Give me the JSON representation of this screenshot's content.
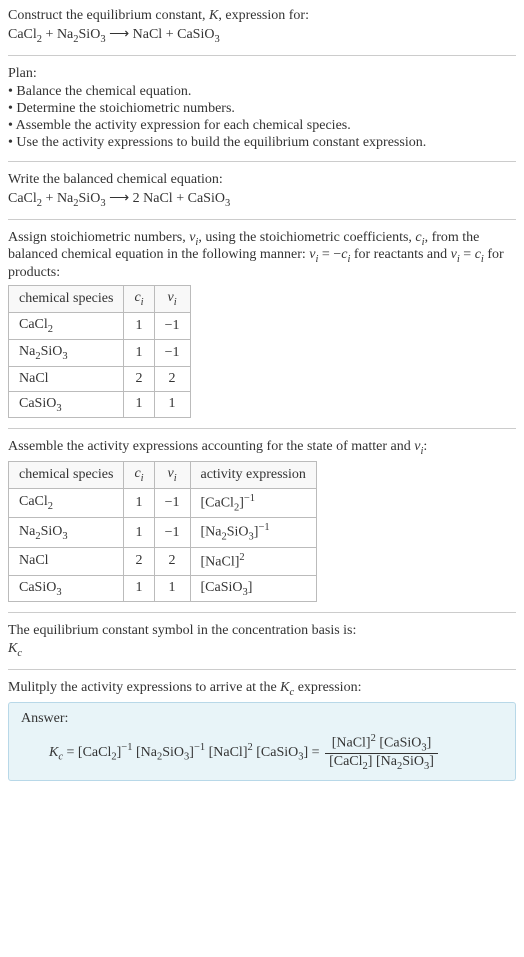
{
  "header": {
    "title_prefix": "Construct the equilibrium constant, ",
    "title_var": "K",
    "title_suffix": ", expression for:",
    "equation_lhs1": "CaCl",
    "equation_lhs1_sub": "2",
    "plus": " + ",
    "equation_lhs2a": "Na",
    "equation_lhs2a_sub": "2",
    "equation_lhs2b": "SiO",
    "equation_lhs2b_sub": "3",
    "arrow": " ⟶ ",
    "equation_rhs1": "NaCl",
    "equation_rhs2a": "CaSiO",
    "equation_rhs2a_sub": "3"
  },
  "plan": {
    "title": "Plan:",
    "items": [
      "• Balance the chemical equation.",
      "• Determine the stoichiometric numbers.",
      "• Assemble the activity expression for each chemical species.",
      "• Use the activity expressions to build the equilibrium constant expression."
    ]
  },
  "balanced": {
    "title": "Write the balanced chemical equation:",
    "coef_nacl": "2 "
  },
  "stoich": {
    "text_a": "Assign stoichiometric numbers, ",
    "nu_i": "ν",
    "nu_i_sub": "i",
    "text_b": ", using the stoichiometric coefficients, ",
    "c_i": "c",
    "c_i_sub": "i",
    "text_c": ", from the balanced chemical equation in the following manner: ",
    "eq1_lhs": "ν",
    "eq1_eq": " = −",
    "text_d": " for reactants and ",
    "eq2_eq": " = ",
    "text_e": " for products:",
    "table": {
      "headers": [
        "chemical species",
        "cᵢ",
        "νᵢ"
      ],
      "h0": "chemical species",
      "h1_a": "c",
      "h1_b": "i",
      "h2_a": "ν",
      "h2_b": "i",
      "rows": [
        {
          "species_a": "CaCl",
          "species_a_sub": "2",
          "species_b": "",
          "species_b_sub": "",
          "c": "1",
          "nu": "−1"
        },
        {
          "species_a": "Na",
          "species_a_sub": "2",
          "species_b": "SiO",
          "species_b_sub": "3",
          "c": "1",
          "nu": "−1"
        },
        {
          "species_a": "NaCl",
          "species_a_sub": "",
          "species_b": "",
          "species_b_sub": "",
          "c": "2",
          "nu": "2"
        },
        {
          "species_a": "CaSiO",
          "species_a_sub": "3",
          "species_b": "",
          "species_b_sub": "",
          "c": "1",
          "nu": "1"
        }
      ]
    }
  },
  "activity": {
    "text_a": "Assemble the activity expressions accounting for the state of matter and ",
    "text_b": ":",
    "table": {
      "h0": "chemical species",
      "h1_a": "c",
      "h1_b": "i",
      "h2_a": "ν",
      "h2_b": "i",
      "h3": "activity expression",
      "rows": [
        {
          "sp_a": "CaCl",
          "sp_a_sub": "2",
          "sp_b": "",
          "sp_b_sub": "",
          "c": "1",
          "nu": "−1",
          "act_a": "[CaCl",
          "act_a_sub": "2",
          "act_b": "]",
          "act_sup": "−1"
        },
        {
          "sp_a": "Na",
          "sp_a_sub": "2",
          "sp_b": "SiO",
          "sp_b_sub": "3",
          "c": "1",
          "nu": "−1",
          "act_a": "[Na",
          "act_a_sub": "2",
          "act_b": "SiO",
          "act_b_sub": "3",
          "act_c": "]",
          "act_sup": "−1"
        },
        {
          "sp_a": "NaCl",
          "sp_a_sub": "",
          "sp_b": "",
          "sp_b_sub": "",
          "c": "2",
          "nu": "2",
          "act_a": "[NaCl]",
          "act_sup": "2"
        },
        {
          "sp_a": "CaSiO",
          "sp_a_sub": "3",
          "sp_b": "",
          "sp_b_sub": "",
          "c": "1",
          "nu": "1",
          "act_a": "[CaSiO",
          "act_a_sub": "3",
          "act_b": "]",
          "act_sup": ""
        }
      ]
    }
  },
  "eqconst": {
    "text": "The equilibrium constant symbol in the concentration basis is:",
    "sym_a": "K",
    "sym_b": "c"
  },
  "multiply": {
    "text_a": "Mulitply the activity expressions to arrive at the ",
    "text_b": " expression:"
  },
  "answer": {
    "label": "Answer:",
    "Kc_a": "K",
    "Kc_b": "c",
    "eq": " = ",
    "t1": "[CaCl",
    "t1s": "2",
    "t1e": "]",
    "t1sup": "−1",
    "sp": " ",
    "t2": "[Na",
    "t2s": "2",
    "t2b": "SiO",
    "t2bs": "3",
    "t2e": "]",
    "t2sup": "−1",
    "t3": "[NaCl]",
    "t3sup": "2",
    "t4": "[CaSiO",
    "t4s": "3",
    "t4e": "]",
    "eq2": " = ",
    "num_a": "[NaCl]",
    "num_a_sup": "2",
    "num_b": "[CaSiO",
    "num_b_sub": "3",
    "num_b_e": "]",
    "den_a": "[CaCl",
    "den_a_sub": "2",
    "den_a_e": "]",
    "den_b": "[Na",
    "den_b_sub": "2",
    "den_bb": "SiO",
    "den_bb_sub": "3",
    "den_b_e": "]"
  }
}
